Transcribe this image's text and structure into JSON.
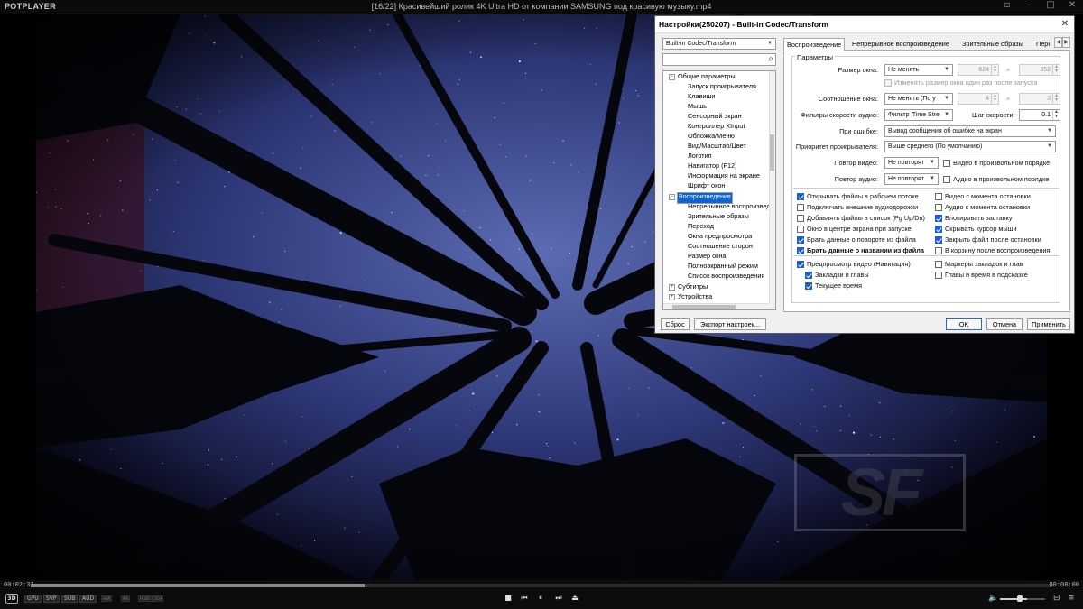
{
  "app": {
    "logo": "POTPLAYER",
    "window_title": "[16/22] Красивейший ролик 4K Ultra HD от компании SAMSUNG под красивую музыку.mp4"
  },
  "player": {
    "time_current": "00:02:37",
    "time_total": "00:08:00",
    "progress": 0.327,
    "volume": 0.6,
    "badges": [
      "GPU",
      "SVP",
      "SUB",
      "AUD"
    ],
    "small_badges": [
      "H/W",
      "AVI",
      "H.265",
      "2CH"
    ],
    "btn_3d": "3D",
    "watermark": "SF"
  },
  "dialog": {
    "title": "Настройки(250207) - Built-in Codec/Transform",
    "codec_select": "Built-in Codec/Transform",
    "tree": {
      "general": "Общие параметры",
      "general_items": [
        "Запуск проигрывателя",
        "Клавиши",
        "Мышь",
        "Сенсорный экран",
        "Контроллер XInput",
        "Обложка/Меню",
        "Вид/Масштаб/Цвет",
        "Логотип",
        "Навигатор (F12)",
        "Информация на экране",
        "Шрифт окон"
      ],
      "playback": "Воспроизведение",
      "playback_items": [
        "Непрерывное воспроизведение",
        "Зрительные образы",
        "Переход",
        "Окна предпросмотра",
        "Соотношение сторон",
        "Размер окна",
        "Полноэкранный режим",
        "Список воспроизведения"
      ],
      "subtitles": "Субтитры",
      "devices": "Устройства"
    },
    "tabs": [
      "Воспроизведение",
      "Непрерывное воспроизведение",
      "Зрительные образы",
      "Пере"
    ],
    "group_label": "Параметры",
    "window_size": {
      "label": "Размер окна:",
      "value": "Не менять",
      "width": "624",
      "height": "352",
      "x": "×"
    },
    "change_once": "Изменять размер окна один раз после запуска",
    "aspect": {
      "label": "Соотношение окна:",
      "value": "Не менять (По у",
      "w": "4",
      "h": "3",
      "x": "×"
    },
    "speed_filter": {
      "label": "Фильтры скорости аудио:",
      "value": "Фильтр 'Time Stre",
      "step_label": "Шаг скорости:",
      "step": "0.1"
    },
    "on_error": {
      "label": "При ошибке:",
      "value": "Вывод сообщения об ошибке на экран"
    },
    "priority": {
      "label": "Приоритет проигрывателя:",
      "value": "Выше среднего (По умолчанию)"
    },
    "repeat_video": {
      "label": "Повтор видео:",
      "value": "Не повторят",
      "random": "Видео в произвольном порядке"
    },
    "repeat_audio": {
      "label": "Повтор аудио:",
      "value": "Не повторят",
      "random": "Аудио в произвольном порядке"
    },
    "left_checks": [
      {
        "label": "Открывать файлы в рабочем потоке",
        "checked": true
      },
      {
        "label": "Подключать внешние аудиодорожки",
        "checked": false
      },
      {
        "label": "Добавлять файлы в список (Pg Up/Dn)",
        "checked": false
      },
      {
        "label": "Окно в центре экрана при запуске",
        "checked": false
      },
      {
        "label": "Брать данные о повороте из файла",
        "checked": true
      },
      {
        "label": "Брать данные о названии из файла",
        "checked": true
      }
    ],
    "right_checks": [
      {
        "label": "Видео с момента остановки",
        "checked": false
      },
      {
        "label": "Аудио с момента остановки",
        "checked": false
      },
      {
        "label": "Блокировать заставку",
        "checked": true
      },
      {
        "label": "Скрывать курсор мыши",
        "checked": true
      },
      {
        "label": "Закрыть файл после остановки",
        "checked": true
      },
      {
        "label": "В корзину после воспроизведения",
        "checked": false
      }
    ],
    "preview": {
      "label": "Предпросмотр видео (Навигация)",
      "bookmarks": "Закладки и главы",
      "current_time": "Текущее время",
      "markers": "Маркеры закладок и глав",
      "chapters_hint": "Главы и время в подсказке"
    },
    "buttons": {
      "reset": "Сброс",
      "export": "Экспорт настроек...",
      "ok": "OK",
      "cancel": "Отмена",
      "apply": "Применить"
    }
  }
}
